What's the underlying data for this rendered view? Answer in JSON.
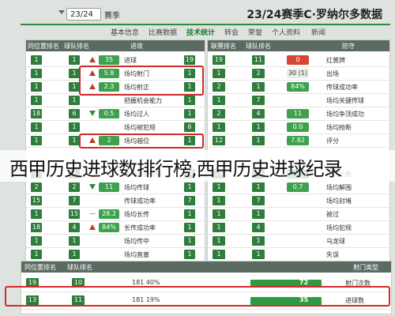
{
  "header": {
    "title": "23/24赛季C·罗纳尔多数据",
    "season_value": "23/24",
    "season_label": "赛季"
  },
  "tabs": [
    "基本信息",
    "比赛数据",
    "技术统计",
    "转会",
    "荣誉",
    "个人资料",
    "新闻"
  ],
  "left_panel": {
    "headers": [
      "同位置排名",
      "球队排名",
      "进攻",
      "数据",
      "联赛排名"
    ],
    "rows": [
      {
        "pos": "1",
        "team": "1",
        "label": "进球",
        "value": "35",
        "arrow": "up",
        "rank": "19"
      },
      {
        "pos": "1",
        "team": "1",
        "label": "场均射门",
        "value": "5.8",
        "arrow": "up",
        "rank": "1"
      },
      {
        "pos": "1",
        "team": "1",
        "label": "场均射正",
        "value": "2.3",
        "arrow": "up",
        "rank": "1"
      },
      {
        "pos": "1",
        "team": "1",
        "label": "把握机会能力",
        "value": "",
        "arrow": "none",
        "rank": "1"
      },
      {
        "pos": "18",
        "team": "6",
        "label": "场均过人",
        "value": "0.5",
        "arrow": "down",
        "rank": "1"
      },
      {
        "pos": "1",
        "team": "1",
        "label": "场均被犯规",
        "value": "",
        "arrow": "none",
        "rank": "6"
      },
      {
        "pos": "1",
        "team": "1",
        "label": "场均越位",
        "value": "2",
        "arrow": "up",
        "rank": "1"
      }
    ],
    "rows2": [
      {
        "pos": "2",
        "team": "1",
        "label": "场均关键传球",
        "value": "",
        "arrow": "none",
        "rank": "36"
      },
      {
        "pos": "2",
        "team": "2",
        "label": "场均传球",
        "value": "11",
        "arrow": "down",
        "rank": "1"
      },
      {
        "pos": "15",
        "team": "7",
        "label": "传球成功率",
        "value": "",
        "arrow": "none",
        "rank": "7"
      },
      {
        "pos": "1",
        "team": "15",
        "label": "场均长传",
        "value": "28.2",
        "arrow": "dash",
        "rank": "1"
      },
      {
        "pos": "18",
        "team": "4",
        "label": "长传成功率",
        "value": "84%",
        "arrow": "up",
        "rank": "1"
      },
      {
        "pos": "1",
        "team": "1",
        "label": "场均传中",
        "value": "",
        "arrow": "none",
        "rank": "1"
      },
      {
        "pos": "1",
        "team": "1",
        "label": "场均直塞",
        "value": "",
        "arrow": "none",
        "rank": "1"
      }
    ]
  },
  "right_panel": {
    "headers": [
      "联赛排名",
      "球队排名",
      "数据",
      "防守"
    ],
    "rows": [
      {
        "rank": "19",
        "team": "11",
        "value": "0",
        "label": "红黄牌",
        "color": "red"
      },
      {
        "rank": "1",
        "team": "2",
        "value": "30 (1)",
        "label": "出场",
        "color": "none"
      },
      {
        "rank": "2",
        "team": "1",
        "value": "84%",
        "label": "传球成功率",
        "color": "green"
      },
      {
        "rank": "1",
        "team": "7",
        "value": "",
        "label": "场均关键传球",
        "color": "none"
      },
      {
        "rank": "2",
        "team": "4",
        "value": "11",
        "label": "场均争顶成功",
        "color": "green"
      },
      {
        "rank": "1",
        "team": "1",
        "value": "0.0",
        "label": "场均抢断",
        "color": "green"
      },
      {
        "rank": "12",
        "team": "1",
        "value": "7.82",
        "label": "评分",
        "color": "green"
      }
    ],
    "rows2": [
      {
        "rank": "36",
        "team": "20",
        "value": "0",
        "label": "场均拦截",
        "color": "green"
      },
      {
        "rank": "1",
        "team": "1",
        "value": "0.7",
        "label": "场均解围",
        "color": "green"
      },
      {
        "rank": "1",
        "team": "7",
        "value": "",
        "label": "场均封堵",
        "color": "none"
      },
      {
        "rank": "1",
        "team": "1",
        "value": "",
        "label": "被过",
        "color": "none"
      },
      {
        "rank": "1",
        "team": "4",
        "value": "",
        "label": "场均犯规",
        "color": "none"
      },
      {
        "rank": "1",
        "team": "1",
        "value": "",
        "label": "乌龙球",
        "color": "none"
      },
      {
        "rank": "1",
        "team": "1",
        "value": "",
        "label": "失误",
        "color": "none"
      }
    ]
  },
  "overlay_text": "西甲历史进球数排行榜,西甲历史进球纪录",
  "bottom": {
    "headers": [
      "同位置排名",
      "球队排名",
      "射门类型"
    ],
    "rows": [
      {
        "pos": "19",
        "team": "10",
        "detail": "181  40%",
        "value": "72",
        "label": "射门次数"
      },
      {
        "pos": "13",
        "team": "11",
        "detail": "181  19%",
        "value": "35",
        "label": "进球数"
      }
    ]
  },
  "colors": {
    "accent": "#2e8b3a",
    "highlight": "#d22a2a",
    "header_bg": "#5c6b62"
  }
}
